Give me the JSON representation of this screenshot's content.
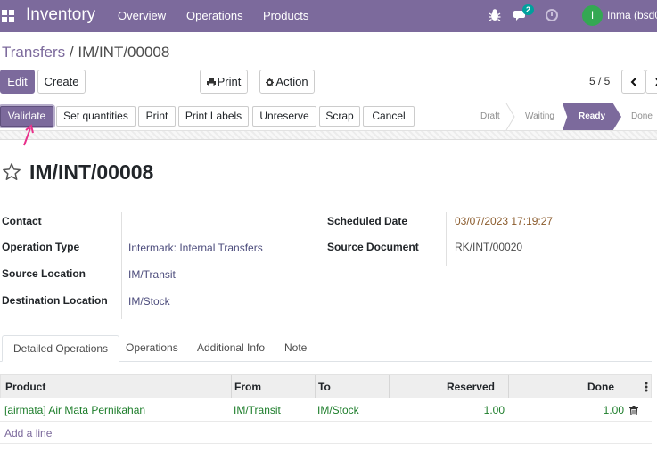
{
  "navbar": {
    "brand": "Inventory",
    "menu": [
      "Overview",
      "Operations",
      "Products"
    ],
    "chat_badge": "2",
    "user_initial": "I",
    "user_name": "Inma (bsd0"
  },
  "breadcrumb": {
    "parent": "Transfers",
    "separator": " / ",
    "current": "IM/INT/00008"
  },
  "toolbar": {
    "edit": "Edit",
    "create": "Create",
    "print": "Print",
    "action": "Action",
    "pager": "5 / 5"
  },
  "statusbar": {
    "buttons": [
      "Validate",
      "Set quantities",
      "Print",
      "Print Labels",
      "Unreserve",
      "Scrap",
      "Cancel"
    ],
    "stages": [
      "Draft",
      "Waiting",
      "Ready",
      "Done"
    ],
    "active_stage": "Ready"
  },
  "record": {
    "title": "IM/INT/00008",
    "fields": {
      "contact_label": "Contact",
      "contact_value": "",
      "operation_type_label": "Operation Type",
      "operation_type_value": "Intermark: Internal Transfers",
      "source_location_label": "Source Location",
      "source_location_value": "IM/Transit",
      "destination_location_label": "Destination Location",
      "destination_location_value": "IM/Stock",
      "scheduled_date_label": "Scheduled Date",
      "scheduled_date_value": "03/07/2023 17:19:27",
      "source_document_label": "Source Document",
      "source_document_value": "RK/INT/00020"
    }
  },
  "notebook": {
    "tabs": [
      "Detailed Operations",
      "Operations",
      "Additional Info",
      "Note"
    ],
    "active": "Detailed Operations"
  },
  "table": {
    "columns": [
      "Product",
      "From",
      "To",
      "Reserved",
      "Done"
    ],
    "rows": [
      {
        "product": "[airmata] Air Mata Pernikahan",
        "from": "IM/Transit",
        "to": "IM/Stock",
        "reserved": "1.00",
        "done": "1.00"
      }
    ],
    "add_line": "Add a line"
  },
  "colors": {
    "brand": "#7c6a9c",
    "date_value": "#8a5a2b",
    "row_text": "#1c7d2a",
    "annotation_arrow": "#e8308a"
  }
}
